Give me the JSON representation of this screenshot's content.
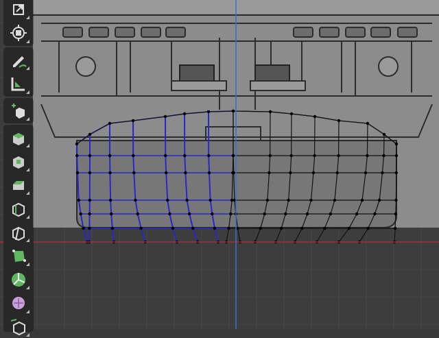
{
  "viewport": {
    "mode": "Edit Mode",
    "colors": {
      "background": "#3d3d3d",
      "grid_line": "#474747",
      "x_axis": "#a7323a",
      "z_axis": "#3f6bd1",
      "reference_image": "#8c8c8c",
      "wire_selected": "#2828c8",
      "wire_unselected": "#111111",
      "vertex": "#000000"
    }
  },
  "toolbar": {
    "active_color": "#4772b3",
    "tools": [
      {
        "name": "scale-cage-tool",
        "icon": "scale-cage-icon",
        "active": false
      },
      {
        "name": "transform-tool",
        "icon": "transform-icon",
        "active": false
      },
      {
        "name": "annotate-tool",
        "icon": "pencil-icon",
        "active": false
      },
      {
        "name": "measure-tool",
        "icon": "ruler-icon",
        "active": false
      },
      {
        "name": "add-cube-tool",
        "icon": "add-cube-icon",
        "active": false
      },
      {
        "name": "extrude-region-tool",
        "icon": "extrude-icon",
        "active": false
      },
      {
        "name": "inset-faces-tool",
        "icon": "inset-icon",
        "active": false
      },
      {
        "name": "bevel-tool",
        "icon": "bevel-icon",
        "active": false
      },
      {
        "name": "loop-cut-tool",
        "icon": "loop-cut-icon",
        "active": false
      },
      {
        "name": "knife-tool",
        "icon": "knife-icon",
        "active": false
      },
      {
        "name": "poly-build-tool",
        "icon": "poly-build-icon",
        "active": false
      },
      {
        "name": "spin-tool",
        "icon": "spin-icon",
        "active": false
      },
      {
        "name": "smooth-tool",
        "icon": "smooth-icon",
        "active": false
      },
      {
        "name": "edge-slide-tool",
        "icon": "edge-slide-icon",
        "active": false
      }
    ]
  }
}
